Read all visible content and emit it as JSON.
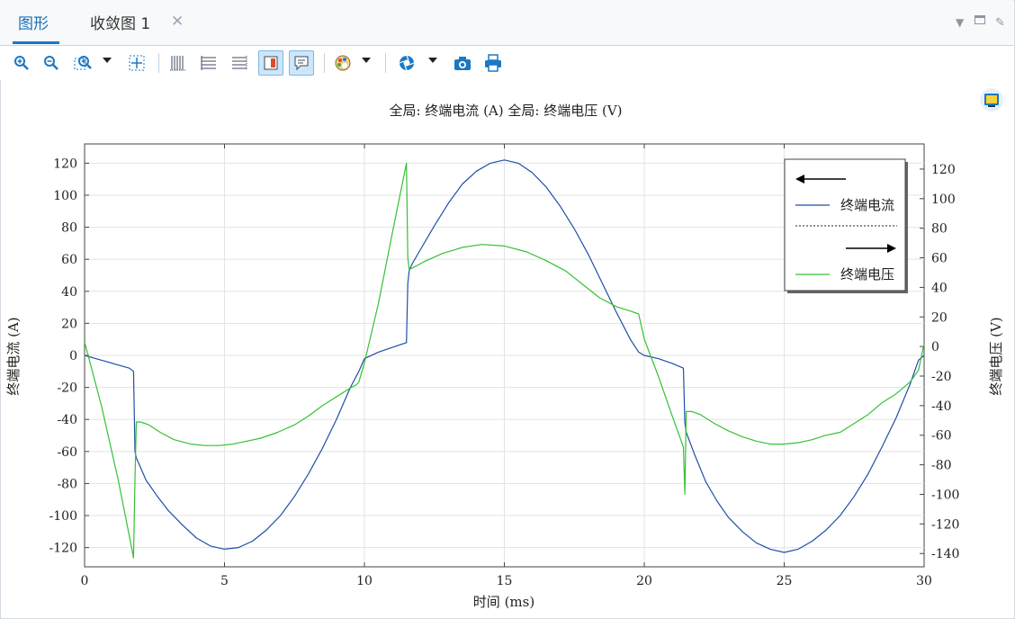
{
  "tabs": [
    {
      "label": "图形",
      "active": true
    },
    {
      "label": "收敛图 1",
      "active": false
    }
  ],
  "tab_close": "✕",
  "plot_title": "全局: 终端电流 (A)  全局: 终端电压 (V)",
  "colors": {
    "current": "#1f4fa8",
    "voltage": "#34c234",
    "accent": "#1b78c4"
  },
  "chart_data": {
    "type": "line",
    "xlabel": "时间 (ms)",
    "ylabel_left": "终端电流 (A)",
    "ylabel_right": "终端电压 (V)",
    "xlim": [
      0,
      30
    ],
    "ylim_left": [
      -132,
      132
    ],
    "ylim_right": [
      -149,
      137
    ],
    "x_ticks": [
      0,
      5,
      10,
      15,
      20,
      25,
      30
    ],
    "y_ticks_left": [
      120,
      100,
      80,
      60,
      40,
      20,
      0,
      -20,
      -40,
      -60,
      -80,
      -100,
      -120
    ],
    "y_ticks_right": [
      120,
      100,
      80,
      60,
      40,
      20,
      0,
      -20,
      -40,
      -60,
      -80,
      -100,
      -120,
      -140
    ],
    "grid": true,
    "legend": {
      "placement": "top-right",
      "entries": [
        "终端电流",
        "终端电压"
      ]
    },
    "series": [
      {
        "name": "终端电流",
        "axis": "left",
        "x": [
          0,
          0.4,
          0.8,
          1.2,
          1.6,
          1.75,
          1.8,
          1.85,
          2.2,
          2.6,
          3.0,
          3.5,
          4.0,
          4.5,
          5.0,
          5.5,
          6.0,
          6.5,
          7.0,
          7.5,
          8.0,
          8.5,
          9.0,
          9.5,
          9.8,
          10.0,
          10.5,
          11.0,
          11.5,
          11.55,
          11.6,
          11.7,
          12.0,
          12.5,
          13.0,
          13.5,
          14.0,
          14.5,
          15.0,
          15.5,
          16.0,
          16.5,
          17.0,
          17.5,
          18.0,
          18.5,
          19.0,
          19.5,
          19.8,
          20.0,
          20.5,
          21.0,
          21.4,
          21.45,
          21.5,
          21.8,
          22.2,
          22.6,
          23.0,
          23.5,
          24.0,
          24.5,
          25.0,
          25.5,
          26.0,
          26.5,
          27.0,
          27.5,
          28.0,
          28.5,
          29.0,
          29.5,
          29.8,
          30.0
        ],
        "y": [
          0,
          -2,
          -4,
          -6,
          -8,
          -10,
          -60,
          -64,
          -78,
          -88,
          -97,
          -106,
          -114,
          -119,
          -121,
          -120,
          -116,
          -109,
          -100,
          -88,
          -74,
          -58,
          -40,
          -20,
          -10,
          -2,
          2,
          5,
          8,
          45,
          53,
          57,
          66,
          81,
          95,
          107,
          115,
          120,
          122,
          120,
          114,
          105,
          93,
          79,
          63,
          45,
          27,
          10,
          2,
          0,
          -2,
          -5,
          -8,
          -42,
          -48,
          -62,
          -79,
          -91,
          -101,
          -110,
          -117,
          -121,
          -123,
          -121,
          -116,
          -109,
          -100,
          -88,
          -74,
          -57,
          -39,
          -18,
          -3,
          0
        ]
      },
      {
        "name": "终端电压",
        "axis": "right",
        "x": [
          0,
          0.6,
          1.2,
          1.7,
          1.75,
          1.8,
          1.85,
          2.0,
          2.3,
          2.7,
          3.2,
          3.8,
          4.3,
          4.8,
          5.3,
          5.8,
          6.3,
          6.9,
          7.5,
          8.0,
          8.5,
          9.0,
          9.5,
          9.7,
          9.8,
          10.0,
          10.5,
          11.0,
          11.5,
          11.55,
          11.6,
          11.8,
          12.2,
          12.8,
          13.5,
          14.2,
          15.0,
          15.8,
          16.5,
          17.2,
          17.8,
          18.4,
          19.0,
          19.5,
          19.8,
          20.0,
          20.5,
          21.0,
          21.4,
          21.45,
          21.5,
          21.7,
          22.0,
          22.5,
          23.0,
          23.5,
          24.0,
          24.5,
          25.0,
          25.5,
          26.0,
          26.5,
          27.0,
          27.5,
          28.0,
          28.5,
          29.0,
          29.5,
          29.8,
          30.0
        ],
        "y": [
          3,
          -40,
          -90,
          -138,
          -143,
          -90,
          -51,
          -51,
          -53,
          -58,
          -63,
          -66,
          -67,
          -67,
          -66,
          -64,
          -62,
          -58,
          -53,
          -47,
          -40,
          -34,
          -28,
          -26,
          -24,
          -11,
          29,
          77,
          124,
          60,
          52,
          54,
          58,
          63,
          67,
          69,
          68,
          64,
          58,
          51,
          42,
          33,
          27,
          24,
          22,
          5,
          -20,
          -47,
          -68,
          -100,
          -44,
          -44,
          -46,
          -52,
          -57,
          -61,
          -64,
          -66,
          -66,
          -65,
          -63,
          -60,
          -58,
          -52,
          -46,
          -38,
          -32,
          -24,
          -16,
          2
        ]
      }
    ]
  }
}
